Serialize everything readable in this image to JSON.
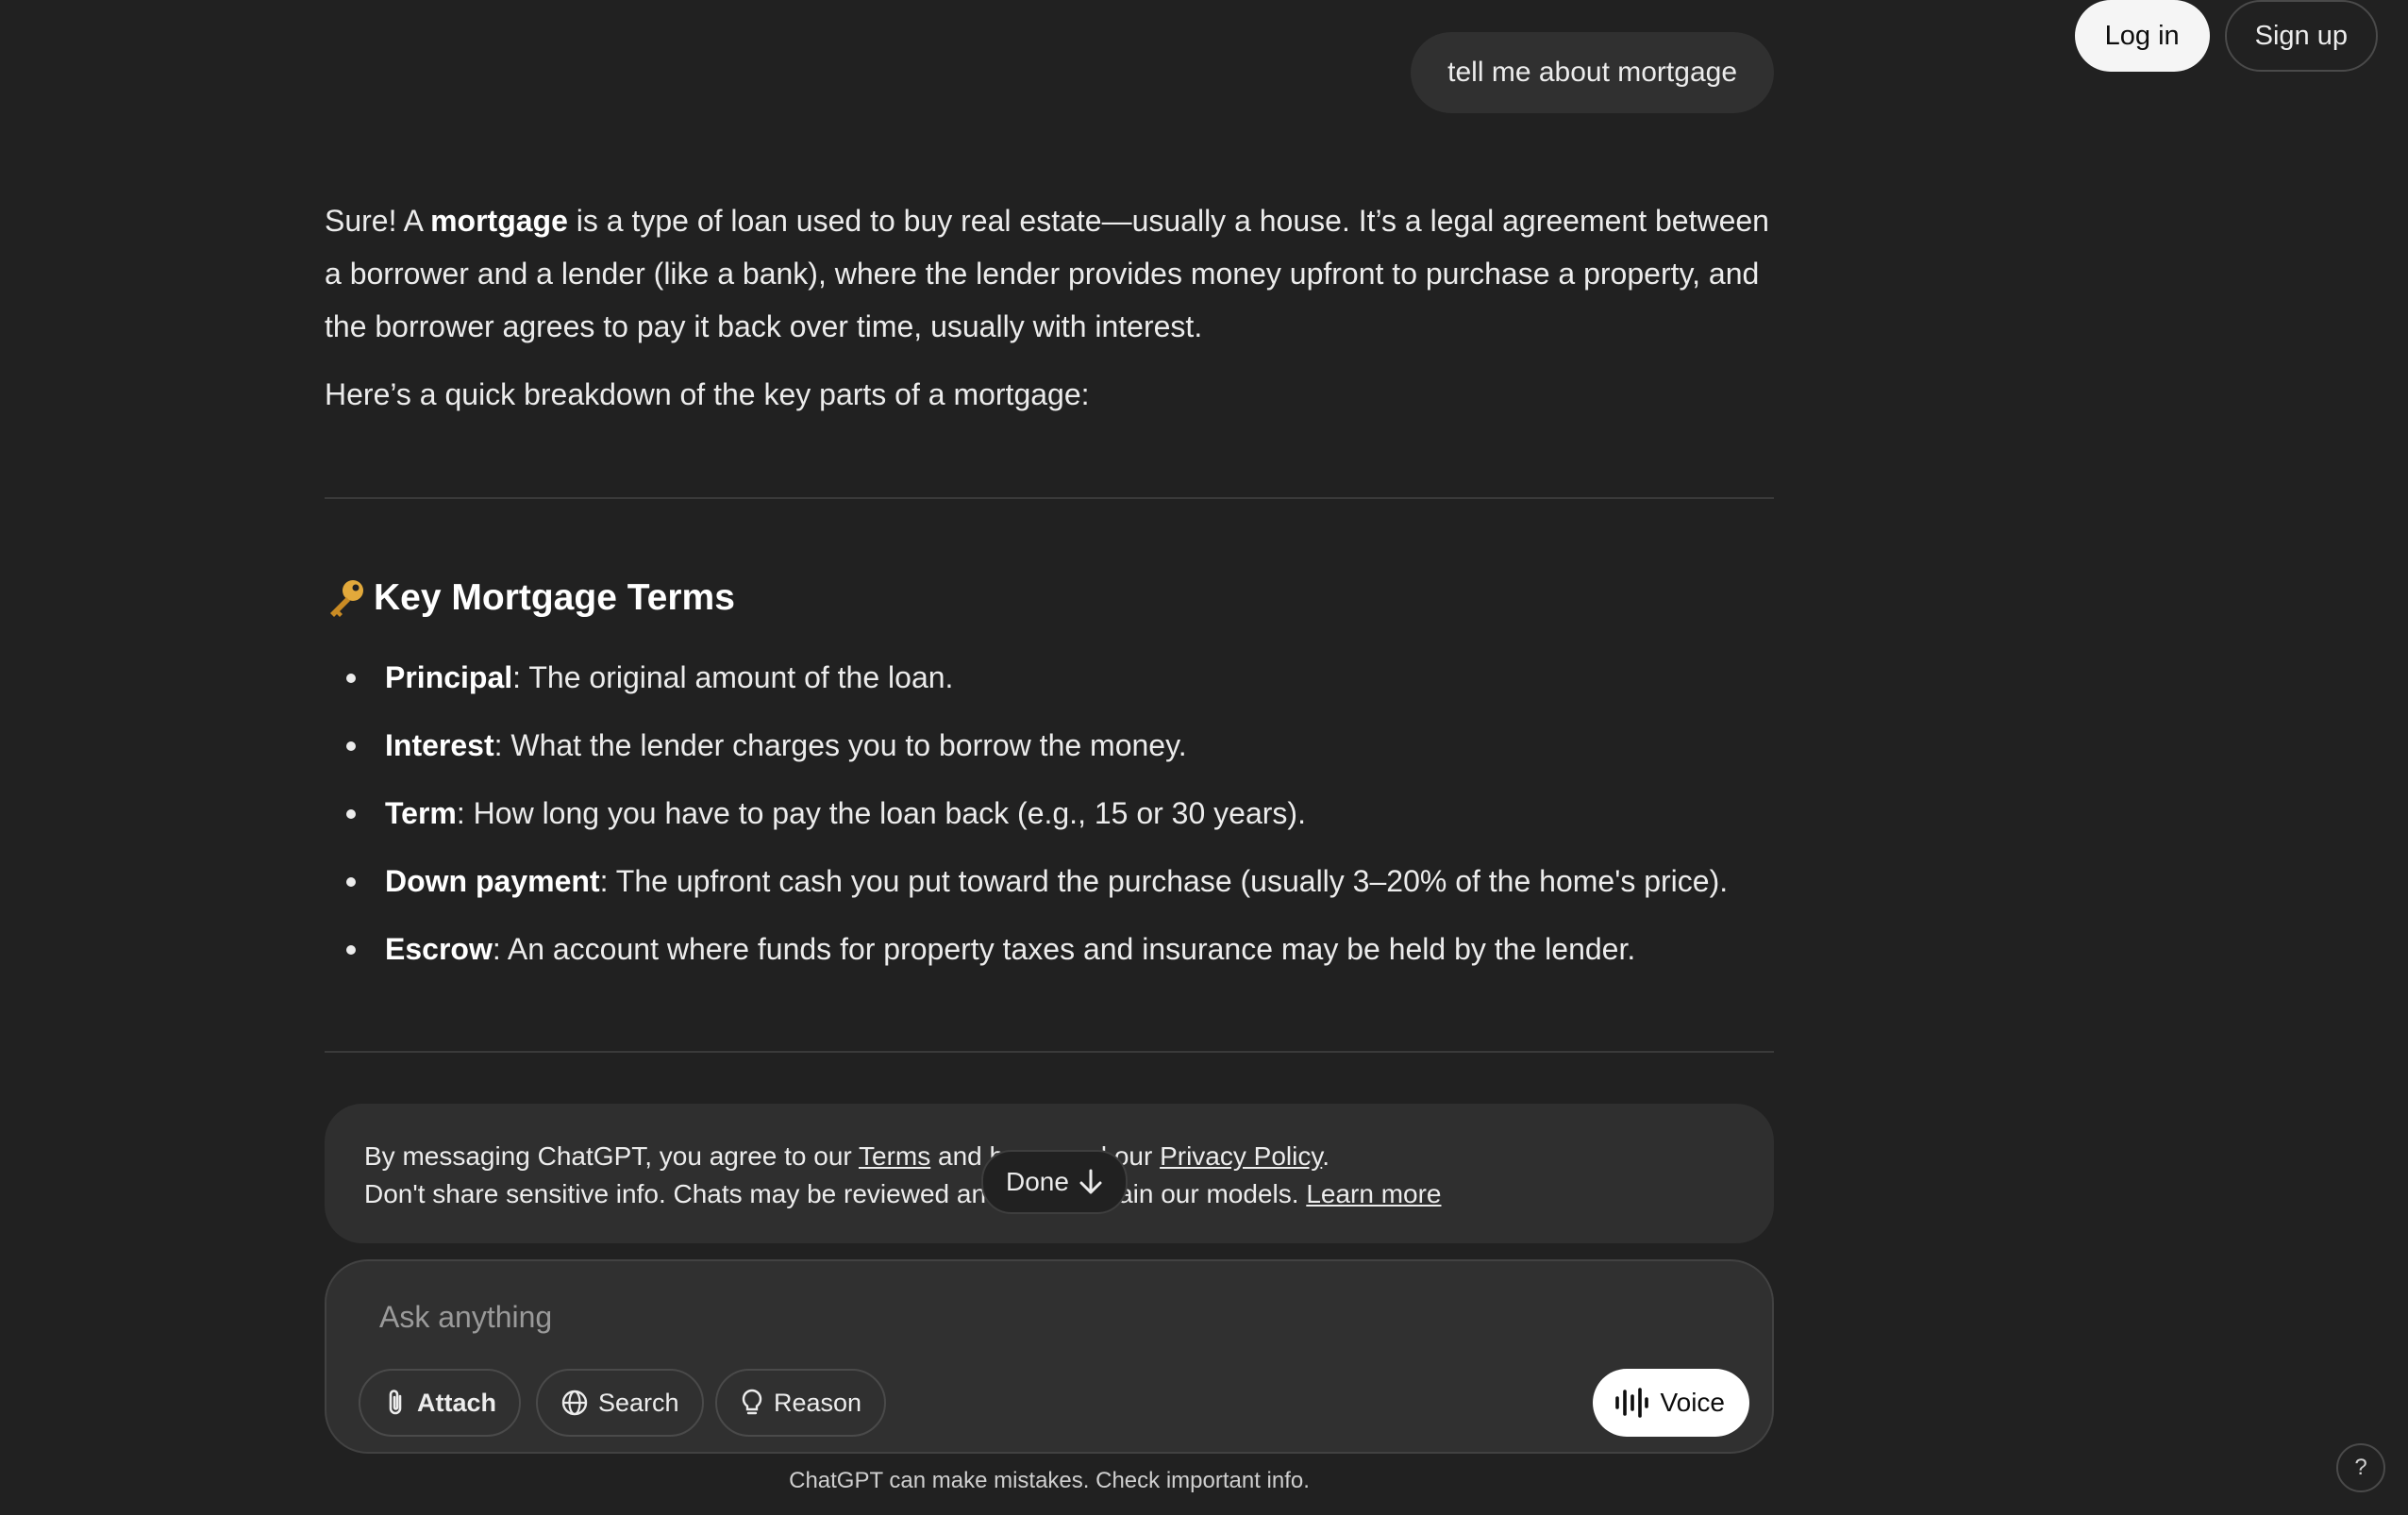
{
  "header": {
    "login_label": "Log in",
    "signup_label": "Sign up"
  },
  "conversation": {
    "user_message": "tell me about mortgage",
    "assistant": {
      "intro_part1": "Sure! A ",
      "intro_bold": "mortgage",
      "intro_part2": " is a type of loan used to buy real estate—usually a house. It’s a legal agreement between a borrower and a lender (like a bank), where the lender provides money upfront to purchase a property, and the borrower agrees to pay it back over time, usually with interest.",
      "intro2": "Here’s a quick breakdown of the key parts of a mortgage:",
      "section_title": "Key Mortgage Terms",
      "terms": [
        {
          "term": "Principal",
          "definition": ": The original amount of the loan."
        },
        {
          "term": "Interest",
          "definition": ": What the lender charges you to borrow the money."
        },
        {
          "term": "Term",
          "definition": ": How long you have to pay the loan back (e.g., 15 or 30 years)."
        },
        {
          "term": "Down payment",
          "definition": ": The upfront cash you put toward the purchase (usually 3–20% of the home's price)."
        },
        {
          "term": "Escrow",
          "definition": ": An account where funds for property taxes and insurance may be held by the lender."
        }
      ]
    }
  },
  "notice": {
    "line1_a": "By messaging ChatGPT, you agree to our ",
    "terms_link": "Terms",
    "line1_b": " and have read our ",
    "privacy_link": "Privacy Policy",
    "line1_c": ".",
    "line2": "Don't share sensitive info. Chats may be reviewed and used to train our models. ",
    "learn_more": "Learn more"
  },
  "scroll_pill": {
    "label": "Done"
  },
  "composer": {
    "placeholder": "Ask anything",
    "attach_label": "Attach",
    "search_label": "Search",
    "reason_label": "Reason",
    "voice_label": "Voice"
  },
  "footer": {
    "disclaimer": "ChatGPT can make mistakes. Check important info.",
    "help_label": "?"
  },
  "icons": {
    "key": "key-icon",
    "attach": "paperclip-icon",
    "search": "globe-icon",
    "reason": "lightbulb-icon",
    "voice": "waveform-icon",
    "down": "arrow-down-icon"
  }
}
